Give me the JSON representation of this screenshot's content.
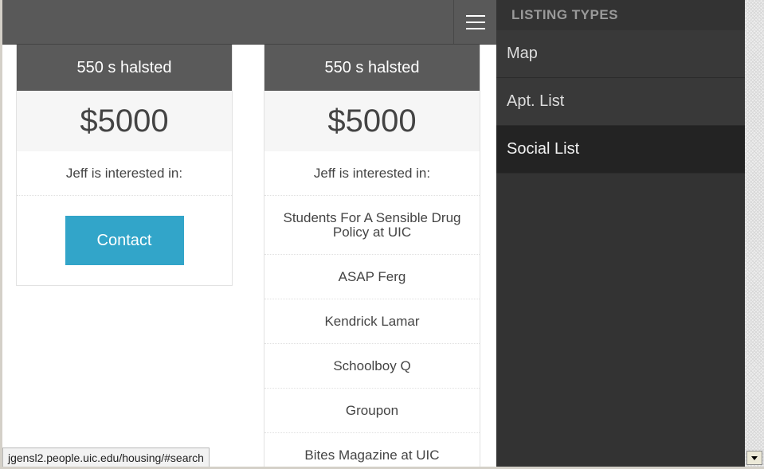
{
  "menu": {
    "icon": "hamburger-menu-icon"
  },
  "listings": [
    {
      "address": "550 s halsted",
      "price": "$5000",
      "interest_label": "Jeff is interested in:",
      "contact_label": "Contact"
    },
    {
      "address": "550 s halsted",
      "price": "$5000",
      "interest_label": "Jeff is interested in:",
      "interests": [
        "Students For A Sensible Drug Policy at UIC",
        "ASAP Ferg",
        "Kendrick Lamar",
        "Schoolboy Q",
        "Groupon",
        "Bites Magazine at UIC"
      ]
    }
  ],
  "sidebar": {
    "title": "LISTING TYPES",
    "items": [
      {
        "label": "Map"
      },
      {
        "label": "Apt. List"
      },
      {
        "label": "Social List"
      }
    ],
    "active_item": "Social List"
  },
  "status_bar": {
    "url": "jgensl2.people.uic.edu/housing/#search"
  },
  "colors": {
    "header_bg": "#595959",
    "contact_button": "#32a5c9",
    "sidebar_bg": "#333333",
    "sidebar_active": "#232323"
  }
}
